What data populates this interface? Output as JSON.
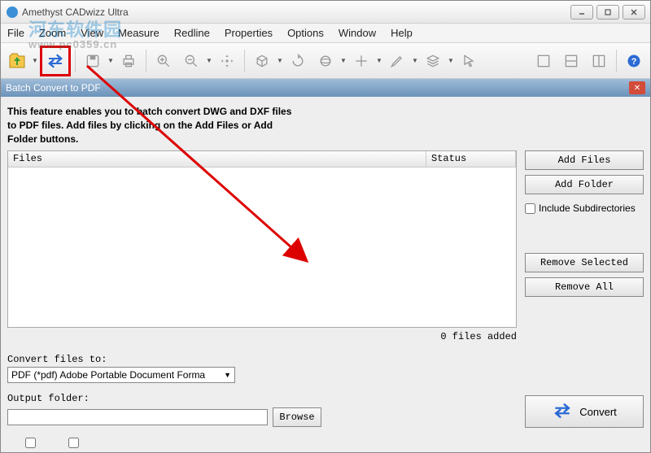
{
  "window": {
    "title": "Amethyst CADwizz Ultra"
  },
  "menu": {
    "file": "File",
    "zoom": "Zoom",
    "view": "View",
    "measure": "Measure",
    "redline": "Redline",
    "properties": "Properties",
    "options": "Options",
    "window": "Window",
    "help": "Help"
  },
  "panel": {
    "title": "Batch Convert to PDF",
    "description_l1": "This feature enables you to batch convert DWG and DXF files",
    "description_l2": "to PDF files. Add files by clicking on the Add Files or Add",
    "description_l3": "Folder buttons.",
    "col_files": "Files",
    "col_status": "Status",
    "add_files": "Add Files",
    "add_folder": "Add Folder",
    "include_subdirs": "Include Subdirectories",
    "remove_selected": "Remove Selected",
    "remove_all": "Remove All",
    "count": "0 files added",
    "convert_to_label": "Convert files to:",
    "convert_format": "PDF (*pdf) Adobe Portable Document Forma",
    "output_label": "Output folder:",
    "browse": "Browse",
    "convert": "Convert"
  },
  "watermark": {
    "main": "河东软件园",
    "sub": "www.pc0359.cn"
  }
}
